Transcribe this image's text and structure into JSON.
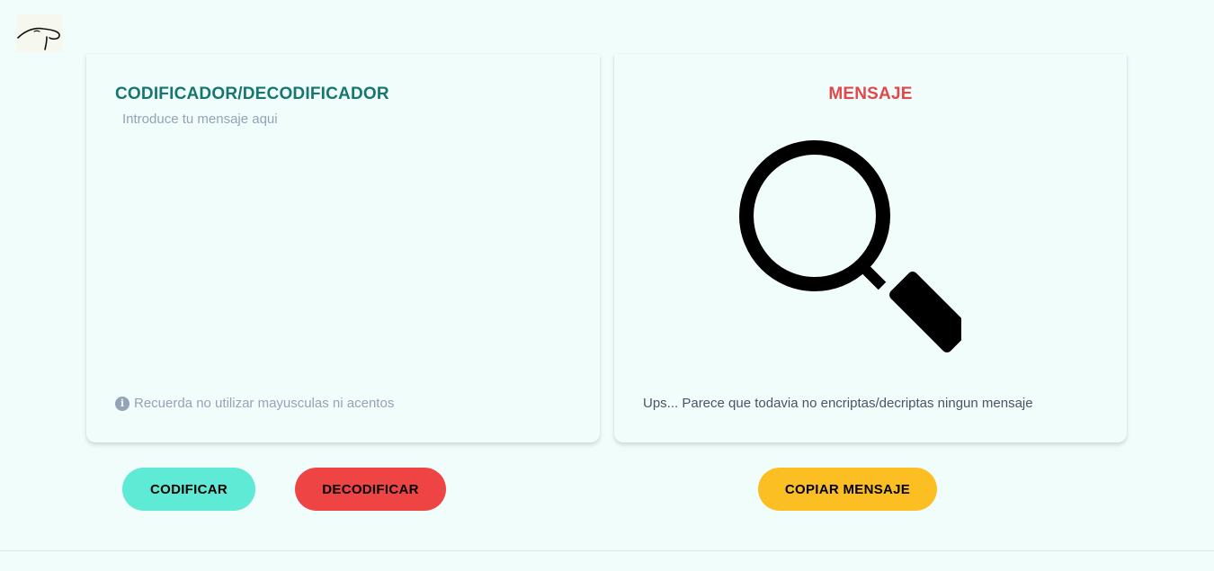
{
  "logo": {
    "icon": "signature-logo-icon"
  },
  "encoder": {
    "title": "CODIFICADOR/DECODIFICADOR",
    "input_value": "",
    "input_placeholder": "Introduce tu mensaje aqui",
    "hint_icon": "info-icon",
    "hint_text": "Recuerda no utilizar mayusculas ni acentos"
  },
  "output": {
    "title": "MENSAJE",
    "empty_icon": "magnifier-icon",
    "empty_text": "Ups... Parece que todavia no encriptas/decriptas ningun mensaje"
  },
  "actions": {
    "encode_label": "CODIFICAR",
    "decode_label": "DECODIFICAR",
    "copy_label": "COPIAR MENSAJE"
  },
  "colors": {
    "background": "#f0fdfa",
    "encoder_title": "#17766f",
    "output_title": "#e0484a",
    "encode_button": "#5eead4",
    "decode_button": "#ef4444",
    "copy_button": "#fbbf24"
  }
}
